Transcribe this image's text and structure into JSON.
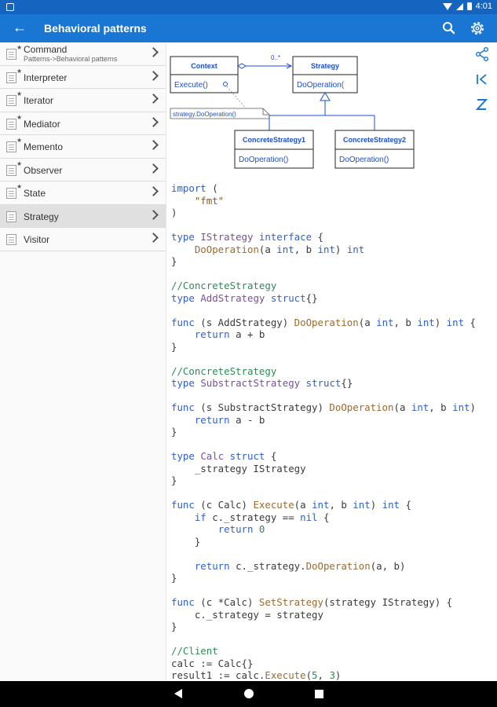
{
  "statusbar": {
    "time": "4:01"
  },
  "appbar": {
    "title": "Behavioral patterns"
  },
  "sidebar": {
    "items": [
      {
        "label": "Command",
        "sublabel": "Patterns->Behavioral patterns",
        "starred": true
      },
      {
        "label": "Interpreter",
        "starred": true
      },
      {
        "label": "Iterator",
        "starred": true
      },
      {
        "label": "Mediator",
        "starred": true
      },
      {
        "label": "Memento",
        "starred": true
      },
      {
        "label": "Observer",
        "starred": true
      },
      {
        "label": "State",
        "starred": true
      },
      {
        "label": "Strategy",
        "starred": false,
        "active": true
      },
      {
        "label": "Visitor",
        "starred": false
      }
    ]
  },
  "diagram": {
    "context": {
      "name": "Context",
      "method": "Execute()"
    },
    "strategy": {
      "name": "Strategy",
      "method": "DoOperation("
    },
    "concrete1": {
      "name": "ConcreteStrategy1",
      "method": "DoOperation()"
    },
    "concrete2": {
      "name": "ConcreteStrategy2",
      "method": "DoOperation()"
    },
    "multiplicity": "0..*",
    "note": "strategy.DoOperation()"
  },
  "code_lines": [
    [
      [
        "kw",
        "import"
      ],
      [
        "p",
        " ("
      ]
    ],
    [
      [
        "p",
        "    "
      ],
      [
        "str",
        "\"fmt\""
      ]
    ],
    [
      [
        "p",
        ")"
      ]
    ],
    [
      [
        "p",
        ""
      ]
    ],
    [
      [
        "kw",
        "type"
      ],
      [
        "p",
        " "
      ],
      [
        "ty",
        "IStrategy"
      ],
      [
        "p",
        " "
      ],
      [
        "kw",
        "interface"
      ],
      [
        "p",
        " {"
      ]
    ],
    [
      [
        "p",
        "    "
      ],
      [
        "fn",
        "DoOperation"
      ],
      [
        "p",
        "(a "
      ],
      [
        "kw",
        "int"
      ],
      [
        "p",
        ", b "
      ],
      [
        "kw",
        "int"
      ],
      [
        "p",
        ") "
      ],
      [
        "kw",
        "int"
      ]
    ],
    [
      [
        "p",
        "}"
      ]
    ],
    [
      [
        "p",
        ""
      ]
    ],
    [
      [
        "cm",
        "//ConcreteStrategy"
      ]
    ],
    [
      [
        "kw",
        "type"
      ],
      [
        "p",
        " "
      ],
      [
        "ty",
        "AddStrategy"
      ],
      [
        "p",
        " "
      ],
      [
        "kw",
        "struct"
      ],
      [
        "p",
        "{}"
      ]
    ],
    [
      [
        "p",
        ""
      ]
    ],
    [
      [
        "kw",
        "func"
      ],
      [
        "p",
        " (s AddStrategy) "
      ],
      [
        "fn",
        "DoOperation"
      ],
      [
        "p",
        "(a "
      ],
      [
        "kw",
        "int"
      ],
      [
        "p",
        ", b "
      ],
      [
        "kw",
        "int"
      ],
      [
        "p",
        ") "
      ],
      [
        "kw",
        "int"
      ],
      [
        "p",
        " {"
      ]
    ],
    [
      [
        "p",
        "    "
      ],
      [
        "kw",
        "return"
      ],
      [
        "p",
        " a + b"
      ]
    ],
    [
      [
        "p",
        "}"
      ]
    ],
    [
      [
        "p",
        ""
      ]
    ],
    [
      [
        "cm",
        "//ConcreteStrategy"
      ]
    ],
    [
      [
        "kw",
        "type"
      ],
      [
        "p",
        " "
      ],
      [
        "ty",
        "SubstractStrategy"
      ],
      [
        "p",
        " "
      ],
      [
        "kw",
        "struct"
      ],
      [
        "p",
        "{}"
      ]
    ],
    [
      [
        "p",
        ""
      ]
    ],
    [
      [
        "kw",
        "func"
      ],
      [
        "p",
        " (s SubstractStrategy) "
      ],
      [
        "fn",
        "DoOperation"
      ],
      [
        "p",
        "(a "
      ],
      [
        "kw",
        "int"
      ],
      [
        "p",
        ", b "
      ],
      [
        "kw",
        "int"
      ],
      [
        "p",
        ")"
      ]
    ],
    [
      [
        "p",
        "    "
      ],
      [
        "kw",
        "return"
      ],
      [
        "p",
        " a - b"
      ]
    ],
    [
      [
        "p",
        "}"
      ]
    ],
    [
      [
        "p",
        ""
      ]
    ],
    [
      [
        "kw",
        "type"
      ],
      [
        "p",
        " "
      ],
      [
        "ty",
        "Calc"
      ],
      [
        "p",
        " "
      ],
      [
        "kw",
        "struct"
      ],
      [
        "p",
        " {"
      ]
    ],
    [
      [
        "p",
        "    _strategy IStrategy"
      ]
    ],
    [
      [
        "p",
        "}"
      ]
    ],
    [
      [
        "p",
        ""
      ]
    ],
    [
      [
        "kw",
        "func"
      ],
      [
        "p",
        " (c Calc) "
      ],
      [
        "fn",
        "Execute"
      ],
      [
        "p",
        "(a "
      ],
      [
        "kw",
        "int"
      ],
      [
        "p",
        ", b "
      ],
      [
        "kw",
        "int"
      ],
      [
        "p",
        ") "
      ],
      [
        "kw",
        "int"
      ],
      [
        "p",
        " {"
      ]
    ],
    [
      [
        "p",
        "    "
      ],
      [
        "kw",
        "if"
      ],
      [
        "p",
        " c._strategy == "
      ],
      [
        "kw",
        "nil"
      ],
      [
        "p",
        " {"
      ]
    ],
    [
      [
        "p",
        "        "
      ],
      [
        "kw",
        "return"
      ],
      [
        "p",
        " "
      ],
      [
        "num",
        "0"
      ]
    ],
    [
      [
        "p",
        "    }"
      ]
    ],
    [
      [
        "p",
        ""
      ]
    ],
    [
      [
        "p",
        "    "
      ],
      [
        "kw",
        "return"
      ],
      [
        "p",
        " c._strategy."
      ],
      [
        "fn",
        "DoOperation"
      ],
      [
        "p",
        "(a, b)"
      ]
    ],
    [
      [
        "p",
        "}"
      ]
    ],
    [
      [
        "p",
        ""
      ]
    ],
    [
      [
        "kw",
        "func"
      ],
      [
        "p",
        " (c *Calc) "
      ],
      [
        "fn",
        "SetStrategy"
      ],
      [
        "p",
        "(strategy IStrategy) {"
      ]
    ],
    [
      [
        "p",
        "    c._strategy = strategy"
      ]
    ],
    [
      [
        "p",
        "}"
      ]
    ],
    [
      [
        "p",
        ""
      ]
    ],
    [
      [
        "cm",
        "//Client"
      ]
    ],
    [
      [
        "p",
        "calc := Calc{}"
      ]
    ],
    [
      [
        "p",
        "result1 := calc."
      ],
      [
        "fn",
        "Execute"
      ],
      [
        "p",
        "("
      ],
      [
        "num",
        "5"
      ],
      [
        "p",
        ", "
      ],
      [
        "num",
        "3"
      ],
      [
        "p",
        ")"
      ]
    ]
  ]
}
